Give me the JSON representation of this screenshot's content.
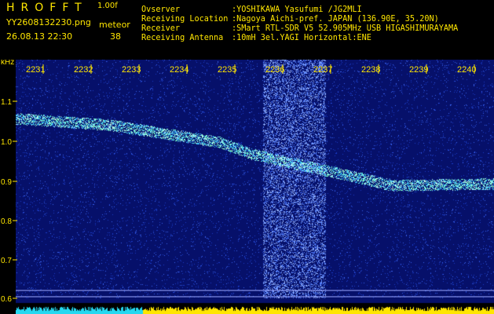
{
  "header": {
    "app_title": "HROFFT",
    "app_version": "1.00f",
    "file_name": "YY2608132230.png",
    "timestamp": "26.08.13 22:30",
    "mode_label": "meteor",
    "count_value": "38"
  },
  "station": {
    "observer_key": "Ovserver",
    "observer_value": ":YOSHIKAWA Yasufumi /JG2MLI",
    "location_key": "Receiving Location",
    "location_value": ":Nagoya Aichi-pref. JAPAN (136.90E, 35.20N)",
    "receiver_key": "Receiver",
    "receiver_value": ":SMart RTL-SDR V5 52.905MHz USB HIGASHIMURAYAMA",
    "antenna_key": "Receiving Antenna",
    "antenna_value": ":10mH 3el.YAGI Horizontal:ENE"
  },
  "spectrogram": {
    "y_unit": "kHz",
    "x_ticks": [
      "2231",
      "2232",
      "2233",
      "2234",
      "2235",
      "2236",
      "2237",
      "2238",
      "2239",
      "2240"
    ],
    "y_ticks": [
      "1.1",
      "1.0",
      "0.9",
      "0.8",
      "0.7",
      "0.6"
    ],
    "colors": {
      "background": "#06106a",
      "noise_light": "#4a78ff",
      "trace": "#7affc8",
      "label": "#ffe600",
      "level_cyan": "#25d8f0",
      "level_yellow": "#ffe600"
    }
  }
}
